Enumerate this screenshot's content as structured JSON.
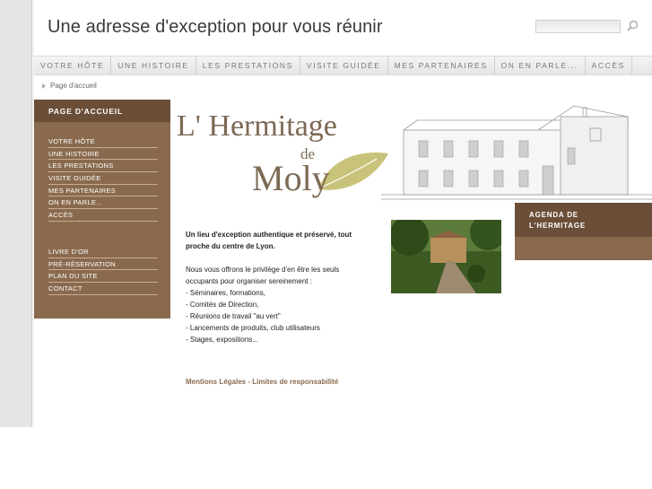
{
  "header": {
    "title": "Une adresse d'exception pour vous réunir",
    "search_placeholder": ""
  },
  "topnav": [
    "VOTRE HÔTE",
    "UNE HISTOIRE",
    "LES PRESTATIONS",
    "VISITE GUIDÉE",
    "MES PARTENAIRES",
    "ON EN PARLE...",
    "ACCÈS"
  ],
  "breadcrumb": "Page d'accueil",
  "sidebar": {
    "heading": "PAGE D'ACCUEIL",
    "items": [
      "VOTRE HÔTE",
      "UNE HISTOIRE",
      "LES PRESTATIONS",
      "VISITE GUIDÉE",
      "MES PARTENAIRES",
      "ON EN PARLE...",
      "ACCÈS"
    ],
    "items2": [
      "LIVRE D'OR",
      "PRÉ-RÉSERVATION",
      "PLAN DU SITE",
      "CONTACT"
    ]
  },
  "logo": {
    "line1": "L' Hermitage",
    "line2": "de",
    "line3": "Moly"
  },
  "agenda": {
    "line1": "AGENDA DE",
    "line2": "L'HERMITAGE"
  },
  "content": {
    "intro_line1": "Un lieu d'exception authentique et préservé, tout",
    "intro_line2": "proche du centre de Lyon.",
    "body": [
      "Nous vous offrons le privilège d'en être les seuls",
      "occupants pour organiser sereinement :",
      "- Séminaires, formations,",
      "- Comités de Direction,",
      "- Réunions de travail \"au vert\"",
      "- Lancements de produits, club utilisateurs",
      "- Stages, expositions..."
    ]
  },
  "footer": {
    "legal": "Mentions Légales",
    "separator": " - ",
    "disclaimer": "Limites de responsabilité"
  },
  "colors": {
    "brown": "#8a6a4e",
    "dark_brown": "#6b4e38",
    "leaf": "#c9c27a"
  }
}
